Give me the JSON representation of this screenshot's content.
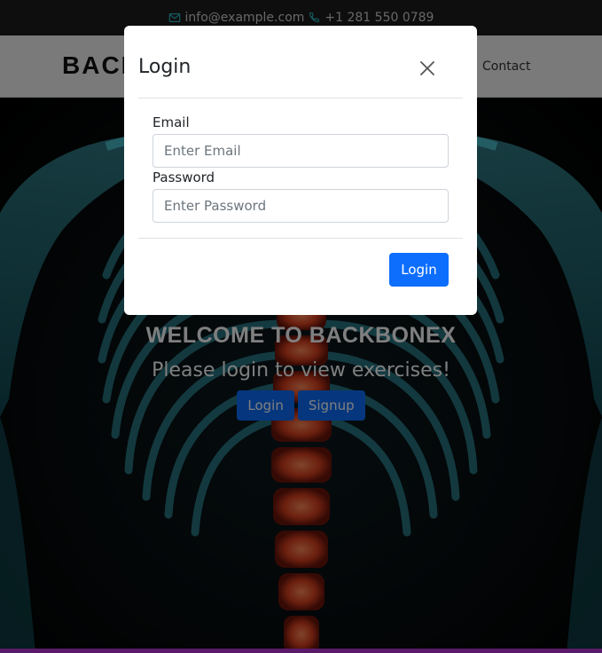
{
  "topbar": {
    "email": "info@example.com",
    "phone": "+1 281 550 0789",
    "email_icon": "envelope-icon",
    "phone_icon": "phone-icon"
  },
  "navbar": {
    "brand": "BACKBONEX",
    "links": [
      "Contact"
    ]
  },
  "hero": {
    "title": "WELCOME TO BACKBONEX",
    "subtitle": "Please login to view exercises!",
    "login_label": "Login",
    "signup_label": "Signup"
  },
  "modal": {
    "title": "Login",
    "close_icon": "close-icon",
    "email_label": "Email",
    "email_placeholder": "Enter Email",
    "password_label": "Password",
    "password_placeholder": "Enter Password",
    "submit_label": "Login"
  },
  "colors": {
    "primary": "#0d6efd",
    "overlay": "rgba(0,0,0,0.5)",
    "bone_glow": "#3fc3d6",
    "spine": "#e0482a"
  }
}
